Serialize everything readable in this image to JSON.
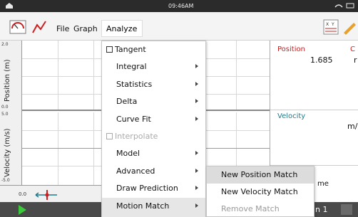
{
  "status_bar": {
    "time": "09:46AM"
  },
  "toolbar": {
    "menu_file": "File",
    "menu_graph": "Graph",
    "menu_analyze": "Analyze",
    "icons": [
      "meter-icon",
      "line-graph-icon",
      "table-toggle-icon",
      "edit-icon"
    ]
  },
  "graphs": {
    "position": {
      "axis_label": "Position (m)",
      "tick_top": "2.0",
      "tick_bottom": "0.0"
    },
    "velocity": {
      "axis_label": "Velocity (m/s)",
      "tick_top": "5.0",
      "tick_bottom": "-5.0"
    },
    "x_tick_start": "0.0"
  },
  "meters": {
    "position": {
      "label": "Position",
      "value": "1.685",
      "unit_fragment": "r",
      "trailing_fragment": "C"
    },
    "velocity": {
      "label": "Velocity",
      "unit_fragment": "m/"
    },
    "time_fragment": "me"
  },
  "bottom_bar": {
    "run_fragment": "n 1"
  },
  "analyze_menu": {
    "items": [
      {
        "label": "Tangent",
        "checkbox": true,
        "enabled": true,
        "submenu": false
      },
      {
        "label": "Integral",
        "checkbox": false,
        "enabled": true,
        "submenu": true
      },
      {
        "label": "Statistics",
        "checkbox": false,
        "enabled": true,
        "submenu": true
      },
      {
        "label": "Delta",
        "checkbox": false,
        "enabled": true,
        "submenu": true
      },
      {
        "label": "Curve Fit",
        "checkbox": false,
        "enabled": true,
        "submenu": true
      },
      {
        "label": "Interpolate",
        "checkbox": true,
        "enabled": false,
        "submenu": false
      },
      {
        "label": "Model",
        "checkbox": false,
        "enabled": true,
        "submenu": true
      },
      {
        "label": "Advanced",
        "checkbox": false,
        "enabled": true,
        "submenu": true
      },
      {
        "label": "Draw Prediction",
        "checkbox": false,
        "enabled": true,
        "submenu": true
      },
      {
        "label": "Motion Match",
        "checkbox": false,
        "enabled": true,
        "submenu": true,
        "hovered": true
      }
    ]
  },
  "motion_match_submenu": {
    "items": [
      {
        "label": "New Position Match",
        "enabled": true,
        "hovered": true
      },
      {
        "label": "New Velocity Match",
        "enabled": true
      },
      {
        "label": "Remove Match",
        "enabled": false
      }
    ]
  },
  "colors": {
    "accent_red": "#cc1f1f",
    "teal": "#1f7a8c",
    "play_green": "#3cc93c"
  }
}
